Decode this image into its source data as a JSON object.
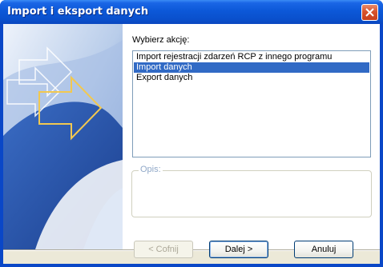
{
  "window": {
    "title": "Import i eksport danych"
  },
  "list": {
    "label": "Wybierz akcję:",
    "items": [
      {
        "label": "Import rejestracji zdarzeń RCP z innego programu",
        "selected": false
      },
      {
        "label": "Import danych",
        "selected": true
      },
      {
        "label": "Export danych",
        "selected": false
      }
    ]
  },
  "description": {
    "title": "Opis:",
    "text": ""
  },
  "buttons": {
    "back": "< Cofnij",
    "next": "Dalej >",
    "cancel": "Anuluj"
  },
  "colors": {
    "titlebar": "#0a50cc",
    "selection": "#316ac5",
    "close": "#d8532c",
    "dialog_bg": "#ece9d8"
  },
  "icons": {
    "close": "close-icon",
    "banner_arrow": "arrow-right-icon"
  }
}
